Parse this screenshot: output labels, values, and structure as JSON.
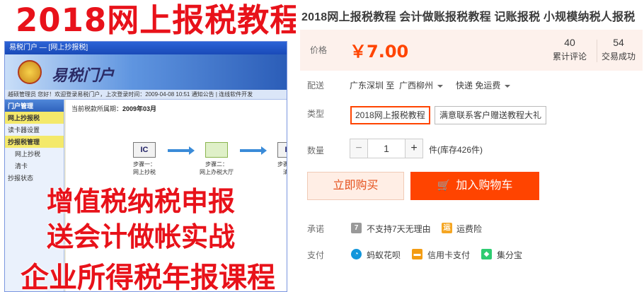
{
  "image": {
    "hero_title": "2018网上报税教程",
    "window_title": "易税门户 — [网上抄报税]",
    "banner": "易税门户",
    "status_bar": "越硕管理员 您好！欢迎登录易税门户，上次登录时间：2009-04-08 10:51    通知公告  |  连线软件开发",
    "sidebar": [
      "门户管理",
      "网上抄报税",
      "读卡器设置",
      "抄报税管理",
      "网上抄税",
      "清卡",
      "抄报状态"
    ],
    "period_label": "当前税款所属期：",
    "period_value": "2009年03月",
    "steps": [
      {
        "box": "IC",
        "label": "步骤一：\n网上抄税"
      },
      {
        "box": "",
        "label": "步骤二：\n网上办税大厅"
      },
      {
        "box": "IC",
        "label": "步骤三：\n清卡"
      }
    ],
    "overlay_line1": "增值税纳税申报",
    "overlay_line2": "送会计做帐实战",
    "overlay_line3": "企业所得税年报课程"
  },
  "title": "2018网上报税教程 会计做账报税教程 记账报税 小规模纳税人报税",
  "price": {
    "label": "价格",
    "currency": "￥",
    "value": "7.00"
  },
  "stats": [
    {
      "num": "40",
      "label": "累计评论"
    },
    {
      "num": "54",
      "label": "交易成功"
    }
  ],
  "shipping": {
    "label": "配送",
    "from": "广东深圳 至",
    "to": "广西柳州",
    "method": "快递 免运费"
  },
  "sku": {
    "label": "类型",
    "options": [
      "2018网上报税教程",
      "满意联系客户赠送教程大礼"
    ],
    "selected_index": 0
  },
  "quantity": {
    "label": "数量",
    "minus": "−",
    "value": "1",
    "plus": "+",
    "stock": "件(库存426件)"
  },
  "buttons": {
    "buy_now": "立即购买",
    "add_to_cart": "加入购物车"
  },
  "promise": {
    "label": "承诺",
    "items": [
      {
        "icon": "seven-day-icon",
        "glyph": "7",
        "text": "不支持7天无理由",
        "color": "#999999"
      },
      {
        "icon": "shipping-insurance-icon",
        "glyph": "运",
        "text": "运费险",
        "color": "#f5a623"
      }
    ]
  },
  "payment": {
    "label": "支付",
    "items": [
      {
        "icon": "huabei-icon",
        "glyph": "◔",
        "text": "蚂蚁花呗",
        "color": "#1296db"
      },
      {
        "icon": "credit-card-icon",
        "glyph": "▬",
        "text": "信用卡支付",
        "color": "#f39c12"
      },
      {
        "icon": "jifenbao-icon",
        "glyph": "◆",
        "text": "集分宝",
        "color": "#2ecc71"
      }
    ]
  },
  "colors": {
    "accent": "#ff4400",
    "price_bg": "#fdf1ec",
    "hero_red": "#e8121a"
  }
}
